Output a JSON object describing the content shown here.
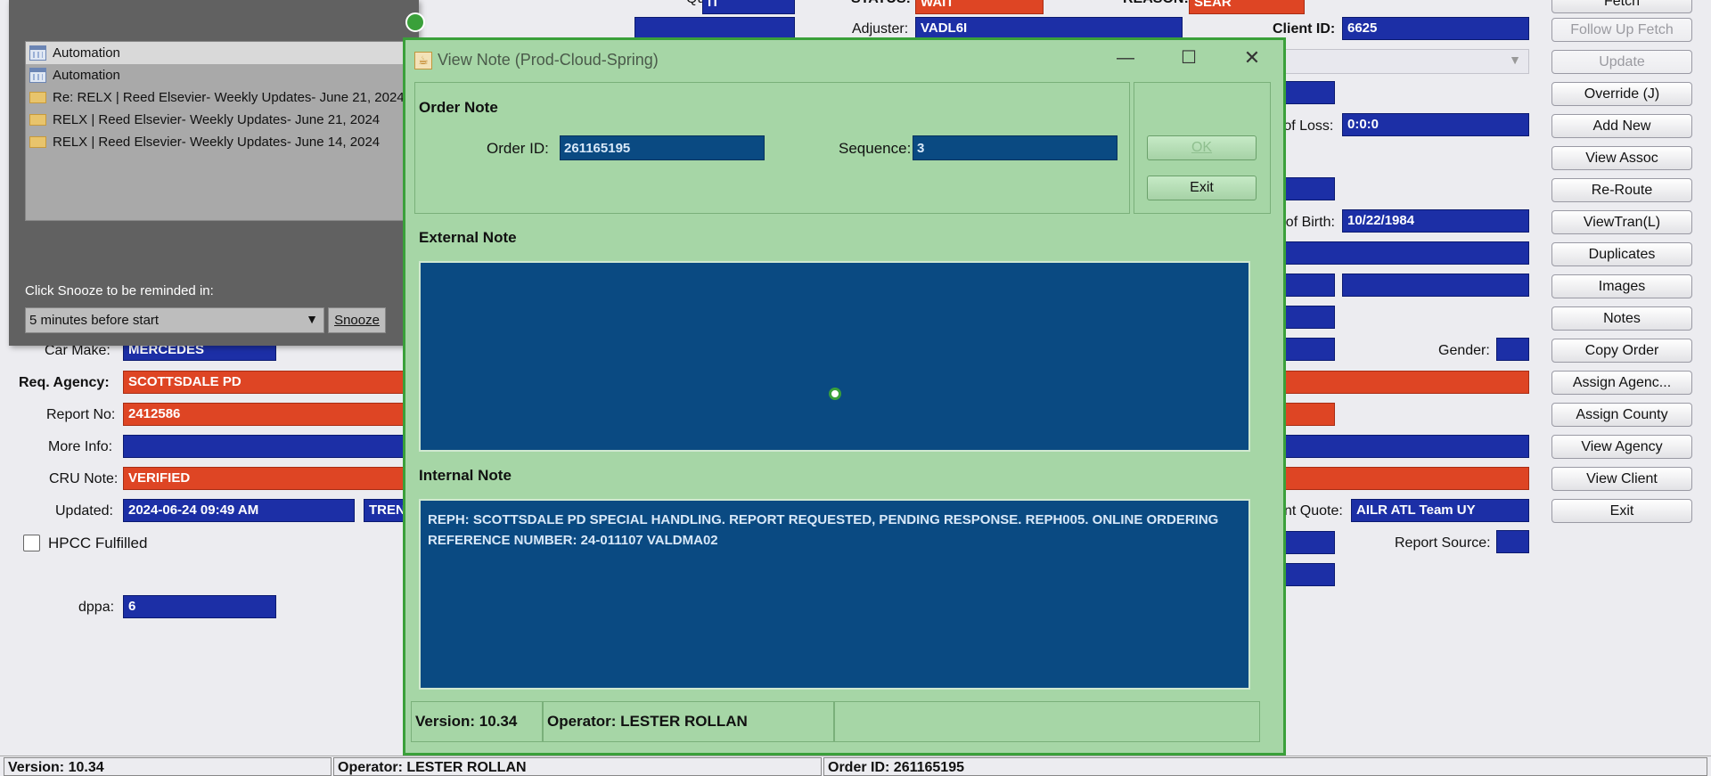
{
  "background_form": {
    "top_labels": {
      "queue_label": "Queue:",
      "queue_value": "IT",
      "status_label": "STATUS:",
      "status_value": "WAIT",
      "reason_label": "REASON:",
      "reason_value": "SEAR",
      "adjuster_label": "Adjuster:",
      "adjuster_value": "VADL6I",
      "client_id_label": "Client ID:",
      "client_id_value": "6625"
    },
    "date_of_loss_label": "e of Loss:",
    "date_of_loss_value": "0:0:0",
    "date_of_birth_label": "te of Birth:",
    "date_of_birth_value": "10/22/1984",
    "gender_label": "Gender:",
    "client_quote_label": "lient Quote:",
    "client_quote_value": "AILR ATL Team UY",
    "report_source_label": "Report Source:",
    "car_make_label": "Car Make:",
    "car_make_value": "MERCEDES",
    "req_agency_label": "Req. Agency:",
    "req_agency_value": "SCOTTSDALE PD",
    "report_no_label": "Report No:",
    "report_no_value": "2412586",
    "more_info_label": "More Info:",
    "cru_note_label": "CRU Note:",
    "cru_note_value": "VERIFIED",
    "updated_label": "Updated:",
    "updated_value": "2024-06-24 09:49 AM",
    "updated_by": "TRENA",
    "hpcc_label": "HPCC Fulfilled",
    "dppa_label": "dppa:",
    "dppa_value": "6"
  },
  "right_buttons": [
    {
      "name": "fetch-button",
      "text": "Fetch",
      "disabled": false
    },
    {
      "name": "follow-up-fetch-button",
      "text": "Follow Up Fetch",
      "disabled": true
    },
    {
      "name": "update-button",
      "text": "Update",
      "disabled": true
    },
    {
      "name": "override-button",
      "text": "Override (J)",
      "disabled": false
    },
    {
      "name": "add-new-button",
      "text": "Add New",
      "disabled": false
    },
    {
      "name": "view-assoc-button",
      "text": "View Assoc",
      "disabled": false
    },
    {
      "name": "re-route-button",
      "text": "Re-Route",
      "disabled": false
    },
    {
      "name": "viewtran-button",
      "text": "ViewTran(L)",
      "disabled": false
    },
    {
      "name": "duplicates-button",
      "text": "Duplicates",
      "disabled": false
    },
    {
      "name": "images-button",
      "text": "Images",
      "disabled": false
    },
    {
      "name": "notes-button",
      "text": "Notes",
      "disabled": false
    },
    {
      "name": "copy-order-button",
      "text": "Copy Order",
      "disabled": false
    },
    {
      "name": "assign-agency-button",
      "text": "Assign Agenc...",
      "disabled": false
    },
    {
      "name": "assign-county-button",
      "text": "Assign County",
      "disabled": false
    },
    {
      "name": "view-agency-button",
      "text": "View Agency",
      "disabled": false
    },
    {
      "name": "view-client-button",
      "text": "View Client",
      "disabled": false
    },
    {
      "name": "exit-main-button",
      "text": "Exit",
      "disabled": false
    }
  ],
  "reminder": {
    "items": [
      {
        "text": "Automation",
        "icon": "calendar-icon",
        "selected": true
      },
      {
        "text": "Automation",
        "icon": "calendar-icon",
        "selected": false
      },
      {
        "text": "Re: RELX | Reed Elsevier- Weekly Updates- June 21, 2024",
        "icon": "envelope-icon",
        "selected": false
      },
      {
        "text": "RELX | Reed Elsevier- Weekly Updates- June 21, 2024",
        "icon": "envelope-icon",
        "selected": false
      },
      {
        "text": "RELX | Reed Elsevier- Weekly Updates- June 14, 2024",
        "icon": "envelope-icon",
        "selected": false
      }
    ],
    "snooze_prompt": "Click Snooze to be reminded in:",
    "snooze_select": "5 minutes before start",
    "snooze_button": "Snooze"
  },
  "modal": {
    "title": "View Note (Prod-Cloud-Spring)",
    "order_note_title": "Order Note",
    "order_id_label": "Order ID:",
    "order_id_value": "261165195",
    "sequence_label": "Sequence:",
    "sequence_value": "3",
    "ok_button": "OK",
    "exit_button": "Exit",
    "external_note_title": "External Note",
    "external_note_text": "",
    "internal_note_title": "Internal Note",
    "internal_note_text": "REPH: SCOTTSDALE PD SPECIAL HANDLING. REPORT REQUESTED, PENDING RESPONSE. REPH005. ONLINE ORDERING REFERENCE NUMBER: 24-011107 VALDMA02",
    "version": "Version: 10.34",
    "operator": "Operator: LESTER ROLLAN"
  },
  "bottom_bar": {
    "version": "Version: 10.34",
    "operator": "Operator: LESTER ROLLAN",
    "order_id": "Order ID: 261165195"
  },
  "colors": {
    "field_blue": "#1c2fa6",
    "field_red": "#de4524",
    "modal_green": "#a6d6a6",
    "note_blue": "#0a4a82"
  }
}
